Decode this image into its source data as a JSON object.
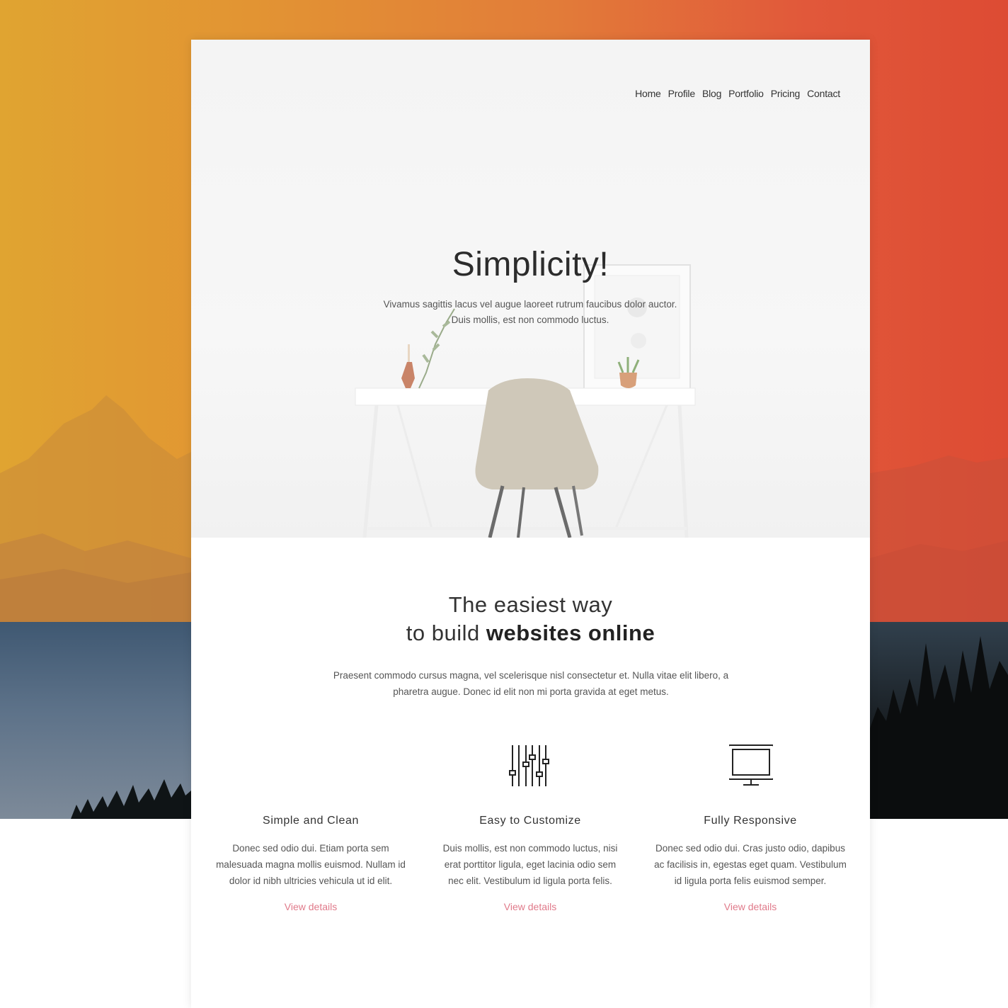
{
  "nav": {
    "items": [
      "Home",
      "Profile",
      "Blog",
      "Portfolio",
      "Pricing",
      "Contact"
    ]
  },
  "hero": {
    "title": "Simplicity!",
    "subtitle_line1": "Vivamus sagittis lacus vel augue laoreet rutrum faucibus dolor auctor.",
    "subtitle_line2": "Duis mollis, est non commodo luctus."
  },
  "intro": {
    "title_line1": "The easiest way",
    "title_line2_prefix": "to build ",
    "title_line2_bold": "websites online",
    "text_line1": "Praesent commodo cursus magna, vel scelerisque nisl consectetur et. Nulla vitae elit libero, a",
    "text_line2": "pharetra augue. Donec id elit non mi porta gravida at eget metus."
  },
  "features": [
    {
      "icon": "blank",
      "title": "Simple and Clean",
      "text_line1": "Donec sed odio dui. Etiam porta sem",
      "text_line2": "malesuada magna mollis euismod. Nullam id",
      "text_line3": "dolor id nibh ultricies vehicula ut id elit.",
      "link": "View details"
    },
    {
      "icon": "sliders-icon",
      "title": "Easy to Customize",
      "text_line1": "Duis mollis, est non commodo luctus, nisi",
      "text_line2": "erat porttitor ligula, eget lacinia odio sem",
      "text_line3": "nec elit. Vestibulum id ligula porta felis.",
      "link": "View details"
    },
    {
      "icon": "monitor-icon",
      "title": "Fully Responsive",
      "text_line1": "Donec sed odio dui. Cras justo odio, dapibus",
      "text_line2": "ac facilisis in, egestas eget quam. Vestibulum",
      "text_line3": "id ligula porta felis euismod semper.",
      "link": "View details"
    }
  ],
  "colors": {
    "link_accent": "#e07a8a",
    "sunset_left": "#e0a431",
    "sunset_right": "#dd4b33"
  }
}
